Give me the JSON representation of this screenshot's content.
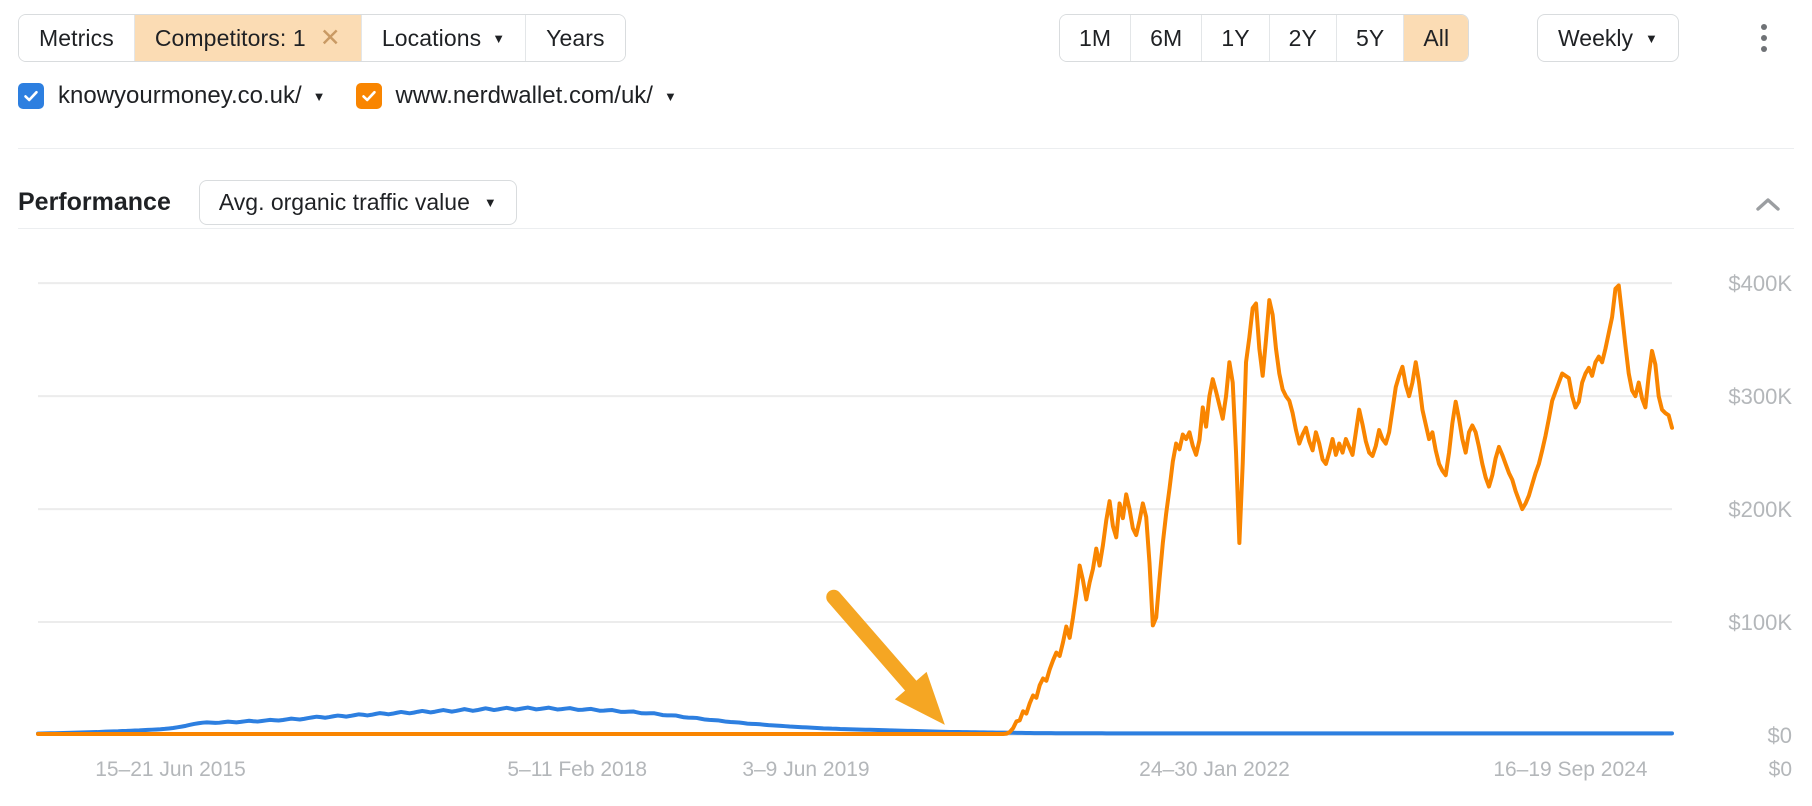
{
  "toolbar": {
    "filters": [
      {
        "label": "Metrics",
        "active": false,
        "caret": false,
        "close": false
      },
      {
        "label": "Competitors: 1",
        "active": true,
        "caret": false,
        "close": true
      },
      {
        "label": "Locations",
        "active": false,
        "caret": true,
        "close": false
      },
      {
        "label": "Years",
        "active": false,
        "caret": false,
        "close": false
      }
    ],
    "close_glyph": "✕",
    "caret_glyph": "▼",
    "ranges": [
      {
        "label": "1M",
        "active": false
      },
      {
        "label": "6M",
        "active": false
      },
      {
        "label": "1Y",
        "active": false
      },
      {
        "label": "2Y",
        "active": false
      },
      {
        "label": "5Y",
        "active": false
      },
      {
        "label": "All",
        "active": true
      }
    ],
    "granularity": "Weekly",
    "more_menu": "more-options"
  },
  "legend": {
    "items": [
      {
        "label": "knowyourmoney.co.uk/",
        "color": "#2d7fe0",
        "checked": true
      },
      {
        "label": "www.nerdwallet.com/uk/",
        "color": "#f98500",
        "checked": true
      }
    ]
  },
  "performance": {
    "title": "Performance",
    "metric": "Avg. organic traffic value",
    "collapsed": false
  },
  "chart_data": {
    "type": "line",
    "title": "Performance",
    "xlabel": "",
    "ylabel": "Avg. organic traffic value",
    "ylim": [
      0,
      440000
    ],
    "ytick_values": [
      0,
      100000,
      200000,
      300000,
      400000
    ],
    "ytick_labels": [
      "$0",
      "$100K",
      "$200K",
      "$300K",
      "$400K"
    ],
    "xtick_labels": [
      "15–21 Jun 2015",
      "5–11 Feb 2018",
      "3–9 Jun 2019",
      "24–30 Jan 2022",
      "16–19 Sep 2024"
    ],
    "xtick_positions": [
      0.035,
      0.33,
      0.47,
      0.72,
      0.985
    ],
    "grid": true,
    "legend_position": "top-left",
    "annotation": {
      "type": "arrow",
      "color": "#f5a623",
      "from": [
        0.487,
        122000
      ],
      "to": [
        0.555,
        9000
      ],
      "note": "Arrow pointing at the take-off point of the orange series"
    },
    "series": [
      {
        "name": "knowyourmoney.co.uk/",
        "color": "#2d7fe0",
        "values": [
          1200,
          1300,
          1400,
          1500,
          1600,
          1700,
          1800,
          1900,
          2000,
          2100,
          2200,
          2300,
          2400,
          2500,
          2600,
          2800,
          3000,
          3100,
          3200,
          3300,
          3500,
          3600,
          3800,
          4000,
          4100,
          4300,
          4500,
          4700,
          4900,
          5100,
          5400,
          5800,
          6200,
          6800,
          7400,
          8100,
          9000,
          9800,
          10400,
          10900,
          11200,
          11000,
          10700,
          10900,
          11400,
          11800,
          11500,
          11200,
          11600,
          12100,
          12600,
          12200,
          11900,
          12400,
          12900,
          13400,
          13100,
          12800,
          13300,
          13900,
          14500,
          14100,
          13700,
          14300,
          15000,
          15600,
          16200,
          15800,
          15300,
          15900,
          16600,
          17200,
          16800,
          16300,
          16900,
          17600,
          18300,
          17900,
          17300,
          17900,
          18700,
          19400,
          18900,
          18300,
          18900,
          19700,
          20400,
          19800,
          19200,
          19800,
          20600,
          21300,
          20700,
          20000,
          20600,
          21400,
          22100,
          21400,
          20700,
          21300,
          22100,
          22900,
          22200,
          21400,
          22000,
          22800,
          23600,
          22900,
          22100,
          22700,
          23400,
          24100,
          23300,
          22500,
          23000,
          23700,
          24300,
          23500,
          22700,
          23100,
          23700,
          24200,
          23400,
          22600,
          22900,
          23400,
          23800,
          23000,
          22200,
          22400,
          22800,
          23100,
          22300,
          21500,
          21600,
          21900,
          22100,
          21300,
          20500,
          20500,
          20700,
          20800,
          20000,
          19200,
          19100,
          19200,
          19200,
          18400,
          17600,
          17400,
          17400,
          17300,
          16500,
          15700,
          15400,
          15300,
          15100,
          14400,
          13700,
          13400,
          13200,
          13000,
          12400,
          11800,
          11500,
          11300,
          11100,
          10600,
          10100,
          9900,
          9700,
          9500,
          9100,
          8700,
          8500,
          8300,
          8100,
          7800,
          7500,
          7300,
          7100,
          6900,
          6700,
          6500,
          6300,
          6100,
          5900,
          5800,
          5600,
          5500,
          5300,
          5200,
          5100,
          5000,
          4900,
          4800,
          4700,
          4600,
          4500,
          4400,
          4300,
          4200,
          4100,
          4000,
          3900,
          3800,
          3700,
          3600,
          3500,
          3400,
          3300,
          3200,
          3100,
          3000,
          2900,
          2800,
          2700,
          2650,
          2600,
          2550,
          2500,
          2450,
          2400,
          2350,
          2300,
          2250,
          2200,
          2150,
          2100,
          2050,
          2000,
          1950,
          1900,
          1850,
          1800,
          1750,
          1700,
          1680,
          1660,
          1640,
          1620,
          1600,
          1590,
          1580,
          1570,
          1560,
          1550,
          1540,
          1530,
          1520,
          1510,
          1500,
          1495,
          1490,
          1485,
          1480,
          1475,
          1470,
          1465,
          1460,
          1455,
          1450,
          1445,
          1440,
          1435,
          1430,
          1425,
          1420,
          1415,
          1410,
          1405,
          1400,
          1400,
          1400,
          1400,
          1400,
          1400,
          1400,
          1400,
          1400,
          1400,
          1400,
          1400,
          1400,
          1400,
          1400,
          1400,
          1400,
          1400,
          1400,
          1400,
          1400,
          1400,
          1400,
          1400,
          1400,
          1400,
          1400,
          1400,
          1400,
          1400,
          1400,
          1400,
          1400,
          1400,
          1400,
          1400,
          1400,
          1400,
          1400,
          1400,
          1400,
          1400,
          1400,
          1400,
          1400,
          1400,
          1400,
          1400,
          1400,
          1400,
          1400,
          1400,
          1400,
          1400,
          1400,
          1400,
          1400,
          1400,
          1400,
          1400,
          1400,
          1400,
          1400,
          1400,
          1400,
          1400,
          1400,
          1400,
          1400,
          1400,
          1400,
          1400,
          1400,
          1400,
          1400,
          1400,
          1400,
          1400,
          1400,
          1400,
          1400,
          1400,
          1400,
          1400,
          1400,
          1400,
          1400,
          1400,
          1400,
          1400,
          1400,
          1400,
          1400,
          1400,
          1400,
          1400,
          1400,
          1400,
          1400,
          1400,
          1400,
          1400,
          1400,
          1400,
          1400,
          1400,
          1400,
          1400,
          1400,
          1400,
          1400,
          1400,
          1400,
          1400,
          1400,
          1400,
          1400
        ],
        "note": "Low flat line; broad hump peaking near 24K around 2019, decaying to ~1.4K after 2021"
      },
      {
        "name": "www.nerdwallet.com/uk/",
        "color": "#f98500",
        "values": [
          900,
          900,
          900,
          900,
          900,
          900,
          900,
          900,
          900,
          900,
          900,
          900,
          900,
          900,
          900,
          900,
          900,
          900,
          900,
          900,
          900,
          900,
          900,
          900,
          900,
          900,
          900,
          900,
          900,
          900,
          900,
          900,
          900,
          900,
          900,
          900,
          900,
          900,
          900,
          900,
          900,
          900,
          900,
          900,
          900,
          900,
          900,
          900,
          900,
          900,
          900,
          900,
          900,
          900,
          900,
          900,
          900,
          900,
          900,
          900,
          900,
          900,
          900,
          900,
          900,
          900,
          900,
          900,
          900,
          900,
          900,
          900,
          900,
          900,
          900,
          900,
          900,
          900,
          900,
          900,
          900,
          900,
          900,
          900,
          900,
          900,
          900,
          900,
          900,
          900,
          900,
          900,
          900,
          900,
          900,
          900,
          900,
          900,
          900,
          900,
          900,
          900,
          900,
          900,
          900,
          900,
          900,
          900,
          900,
          900,
          900,
          900,
          900,
          900,
          900,
          900,
          900,
          900,
          900,
          900,
          900,
          900,
          900,
          900,
          900,
          900,
          900,
          900,
          900,
          900,
          900,
          900,
          900,
          900,
          900,
          900,
          900,
          900,
          900,
          900,
          900,
          900,
          900,
          900,
          900,
          900,
          900,
          900,
          900,
          900,
          900,
          900,
          900,
          900,
          900,
          900,
          900,
          900,
          900,
          900,
          900,
          900,
          900,
          900,
          900,
          900,
          900,
          900,
          900,
          900,
          900,
          900,
          900,
          900,
          900,
          900,
          900,
          900,
          900,
          900,
          900,
          900,
          900,
          900,
          900,
          900,
          900,
          900,
          900,
          900,
          900,
          900,
          900,
          900,
          900,
          900,
          900,
          900,
          900,
          900,
          900,
          900,
          900,
          900,
          900,
          900,
          900,
          900,
          900,
          900,
          900,
          900,
          900,
          900,
          900,
          900,
          900,
          900,
          900,
          900,
          900,
          900,
          900,
          900,
          900,
          900,
          900,
          900,
          900,
          900,
          900,
          900,
          900,
          900,
          900,
          900,
          900,
          900,
          900,
          900,
          900,
          900,
          900,
          900,
          900,
          900,
          900,
          900,
          900,
          900,
          900,
          900,
          900,
          900,
          900,
          900,
          900,
          900,
          900,
          900,
          900,
          900,
          900,
          900,
          900,
          900,
          900,
          900,
          900,
          900,
          900,
          900,
          900,
          900,
          900,
          900,
          900,
          900,
          900,
          900,
          900,
          900,
          900,
          900,
          900,
          900,
          900,
          900,
          900,
          900,
          900,
          1200,
          2600,
          6000,
          12000,
          13000,
          21000,
          19000,
          28000,
          35000,
          33000,
          44000,
          50000,
          48000,
          58000,
          66000,
          73000,
          70000,
          82000,
          96000,
          86000,
          104000,
          125000,
          150000,
          137000,
          120000,
          135000,
          147000,
          165000,
          150000,
          168000,
          190000,
          207000,
          185000,
          175000,
          205000,
          192000,
          213000,
          200000,
          183000,
          177000,
          190000,
          205000,
          193000,
          152000,
          97000,
          104000,
          138000,
          170000,
          196000,
          218000,
          242000,
          258000,
          253000,
          266000,
          262000,
          268000,
          256000,
          248000,
          261000,
          290000,
          273000,
          300000,
          315000,
          304000,
          292000,
          280000,
          300000,
          330000,
          312000,
          250000,
          170000,
          240000,
          330000,
          352000,
          378000,
          382000,
          342000,
          318000,
          350000,
          385000,
          372000,
          342000,
          320000,
          306000,
          300000,
          296000,
          285000,
          270000,
          258000,
          266000,
          272000,
          260000,
          252000,
          268000,
          258000,
          244000,
          240000,
          250000,
          262000,
          248000,
          258000,
          250000,
          262000,
          255000,
          248000,
          268000,
          288000,
          275000,
          260000,
          250000,
          247000,
          256000,
          270000,
          262000,
          258000,
          268000,
          288000,
          308000,
          318000,
          326000,
          310000,
          300000,
          312000,
          330000,
          312000,
          288000,
          275000,
          262000,
          268000,
          252000,
          240000,
          234000,
          230000,
          250000,
          276000,
          295000,
          280000,
          262000,
          250000,
          268000,
          274000,
          268000,
          255000,
          240000,
          228000,
          220000,
          230000,
          245000,
          255000,
          248000,
          240000,
          232000,
          226000,
          216000,
          208000,
          200000,
          205000,
          212000,
          222000,
          232000,
          240000,
          252000,
          265000,
          280000,
          296000,
          304000,
          312000,
          320000,
          318000,
          316000,
          300000,
          290000,
          295000,
          312000,
          320000,
          325000,
          318000,
          330000,
          335000,
          330000,
          342000,
          356000,
          370000,
          395000,
          398000,
          372000,
          345000,
          320000,
          305000,
          300000,
          312000,
          298000,
          290000,
          318000,
          340000,
          328000,
          300000,
          288000,
          285000,
          283000,
          272000
        ],
        "note": "Near-zero until late 2020, then rapid rise to ~$400K peaks with volatile plateau"
      }
    ]
  }
}
